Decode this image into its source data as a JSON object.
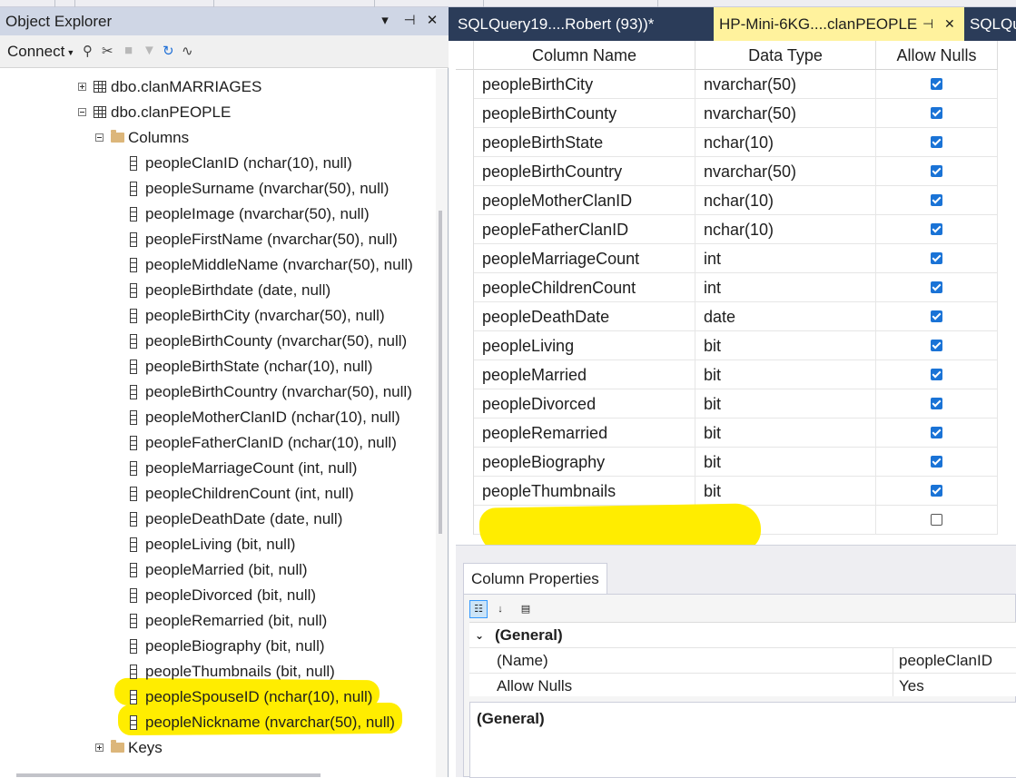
{
  "object_explorer": {
    "title": "Object Explorer",
    "pin_glyph": "▾",
    "autohide_glyph": "⊣",
    "close_glyph": "✕",
    "connect_label": "Connect",
    "tree": {
      "marriages_table": "dbo.clanMARRIAGES",
      "people_table": "dbo.clanPEOPLE",
      "columns_folder": "Columns",
      "columns": [
        "peopleClanID (nchar(10), null)",
        "peopleSurname (nvarchar(50), null)",
        "peopleImage (nvarchar(50), null)",
        "peopleFirstName (nvarchar(50), null)",
        "peopleMiddleName (nvarchar(50), null)",
        "peopleBirthdate (date, null)",
        "peopleBirthCity (nvarchar(50), null)",
        "peopleBirthCounty (nvarchar(50), null)",
        "peopleBirthState (nchar(10), null)",
        "peopleBirthCountry (nvarchar(50), null)",
        "peopleMotherClanID (nchar(10), null)",
        "peopleFatherClanID (nchar(10), null)",
        "peopleMarriageCount (int, null)",
        "peopleChildrenCount (int, null)",
        "peopleDeathDate (date, null)",
        "peopleLiving (bit, null)",
        "peopleMarried (bit, null)",
        "peopleDivorced (bit, null)",
        "peopleRemarried (bit, null)",
        "peopleBiography (bit, null)",
        "peopleThumbnails (bit, null)",
        "peopleSpouseID (nchar(10), null)",
        "peopleNickname (nvarchar(50), null)"
      ],
      "keys_folder": "Keys"
    }
  },
  "tabs": [
    {
      "label": "SQLQuery19....Robert (93))*",
      "active": false
    },
    {
      "label": "HP-Mini-6KG....clanPEOPLE",
      "active": true
    },
    {
      "label": "SQLQu",
      "active": false
    }
  ],
  "tab_pin_glyph": "⊣",
  "tab_close_glyph": "✕",
  "designer": {
    "headers": {
      "name": "Column Name",
      "type": "Data Type",
      "nulls": "Allow Nulls"
    },
    "rows": [
      {
        "name": "peopleBirthCity",
        "type": "nvarchar(50)",
        "nulls": true
      },
      {
        "name": "peopleBirthCounty",
        "type": "nvarchar(50)",
        "nulls": true
      },
      {
        "name": "peopleBirthState",
        "type": "nchar(10)",
        "nulls": true
      },
      {
        "name": "peopleBirthCountry",
        "type": "nvarchar(50)",
        "nulls": true
      },
      {
        "name": "peopleMotherClanID",
        "type": "nchar(10)",
        "nulls": true
      },
      {
        "name": "peopleFatherClanID",
        "type": "nchar(10)",
        "nulls": true
      },
      {
        "name": "peopleMarriageCount",
        "type": "int",
        "nulls": true
      },
      {
        "name": "peopleChildrenCount",
        "type": "int",
        "nulls": true
      },
      {
        "name": "peopleDeathDate",
        "type": "date",
        "nulls": true
      },
      {
        "name": "peopleLiving",
        "type": "bit",
        "nulls": true
      },
      {
        "name": "peopleMarried",
        "type": "bit",
        "nulls": true
      },
      {
        "name": "peopleDivorced",
        "type": "bit",
        "nulls": true
      },
      {
        "name": "peopleRemarried",
        "type": "bit",
        "nulls": true
      },
      {
        "name": "peopleBiography",
        "type": "bit",
        "nulls": true
      },
      {
        "name": "peopleThumbnails",
        "type": "bit",
        "nulls": true
      },
      {
        "name": "",
        "type": "",
        "nulls": false
      }
    ]
  },
  "column_properties": {
    "tab_label": "Column Properties",
    "category": "(General)",
    "props": [
      {
        "key": "(Name)",
        "value": "peopleClanID"
      },
      {
        "key": "Allow Nulls",
        "value": "Yes"
      }
    ],
    "description_title": "(General)"
  },
  "colors": {
    "tabbar_bg": "#2b3c59",
    "active_tab_bg": "#fff29d",
    "checkbox_blue": "#1a73d6",
    "highlighter": "#ffed00"
  }
}
